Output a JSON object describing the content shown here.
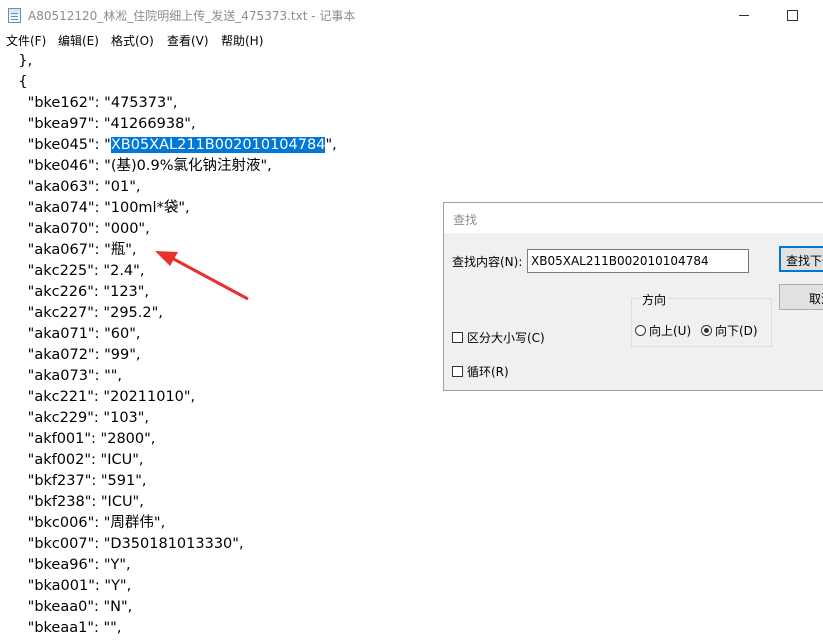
{
  "window": {
    "title": "A80512120_林凇_住院明细上传_发送_475373.txt - 记事本",
    "minimize_icon": "minimize-icon",
    "maximize_icon": "maximize-icon"
  },
  "menu": [
    "文件(F)",
    "编辑(E)",
    "格式(O)",
    "查看(V)",
    "帮助(H)"
  ],
  "editor": {
    "lines": [
      "    },",
      "    {",
      "      \"bke162\": \"475373\",",
      "      \"bkea97\": \"41266938\",",
      "      \"bke045\": \"",
      "      \"bke046\": \"(基)0.9%氯化钠注射液\",",
      "      \"aka063\": \"01\",",
      "      \"aka074\": \"100ml*袋\",",
      "      \"aka070\": \"000\",",
      "      \"aka067\": \"瓶\",",
      "      \"akc225\": \"2.4\",",
      "      \"akc226\": \"123\",",
      "      \"akc227\": \"295.2\",",
      "      \"aka071\": \"60\",",
      "      \"aka072\": \"99\",",
      "      \"aka073\": \"\",",
      "      \"akc221\": \"20211010\",",
      "      \"akc229\": \"103\",",
      "      \"akf001\": \"2800\",",
      "      \"akf002\": \"ICU\",",
      "      \"bkf237\": \"591\",",
      "      \"bkf238\": \"ICU\",",
      "      \"bkc006\": \"周群伟\",",
      "      \"bkc007\": \"D350181013330\",",
      "      \"bkea96\": \"Y\",",
      "      \"bka001\": \"Y\",",
      "      \"bkeaa0\": \"N\",",
      "      \"bkeaa1\": \"\","
    ],
    "highlight_text": "XB05XAL211B002010104784",
    "highlight_suffix": "\","
  },
  "find_dialog": {
    "title": "查找",
    "find_label": "查找内容(N):",
    "find_value": "XB05XAL211B002010104784",
    "find_next_label": "查找下一个(F)",
    "cancel_label": "取消",
    "direction_label": "方向",
    "up_label": "向上(U)",
    "down_label": "向下(D)",
    "direction_selected": "down",
    "match_case_label": "区分大小写(C)",
    "wrap_label": "循环(R)",
    "match_case_checked": false,
    "wrap_checked": false
  },
  "annotation": {
    "arrow_color": "#e8302e"
  },
  "colors": {
    "selection": "#0078d7"
  }
}
